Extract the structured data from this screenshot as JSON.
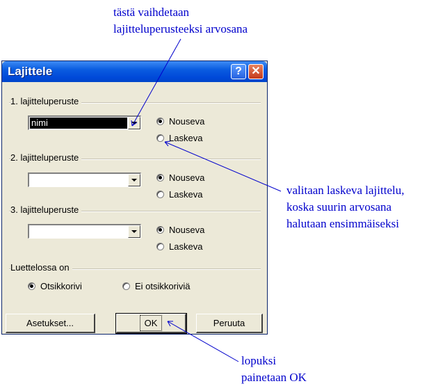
{
  "annotations": {
    "top_line1": "tästä vaihdetaan",
    "top_line2": "lajitteluperusteeksi arvosana",
    "right_line1": "valitaan laskeva lajittelu,",
    "right_line2": "koska suurin arvosana",
    "right_line3": "halutaan ensimmäiseksi",
    "bottom_line1": "lopuksi",
    "bottom_line2": "painetaan OK"
  },
  "dialog": {
    "title": "Lajittele",
    "help_label": "?",
    "close_label": "✕",
    "sort1": {
      "label": "1. lajitteluperuste",
      "value": "nimi",
      "ascending": "Nouseva",
      "descending": "Laskeva",
      "selected": "ascending"
    },
    "sort2": {
      "label": "2. lajitteluperuste",
      "value": "",
      "ascending": "Nouseva",
      "descending": "Laskeva",
      "selected": "ascending"
    },
    "sort3": {
      "label": "3. lajitteluperuste",
      "value": "",
      "ascending": "Nouseva",
      "descending": "Laskeva",
      "selected": "ascending"
    },
    "header": {
      "label": "Luettelossa on",
      "with_header": "Otsikkorivi",
      "no_header": "Ei otsikkoriviä",
      "selected": "with_header"
    },
    "buttons": {
      "options": "Asetukset...",
      "ok": "OK",
      "cancel": "Peruuta"
    }
  },
  "colors": {
    "annotation": "#0000cc",
    "titlebar": "#0a5ce0",
    "dialog_bg": "#ece9d8"
  }
}
